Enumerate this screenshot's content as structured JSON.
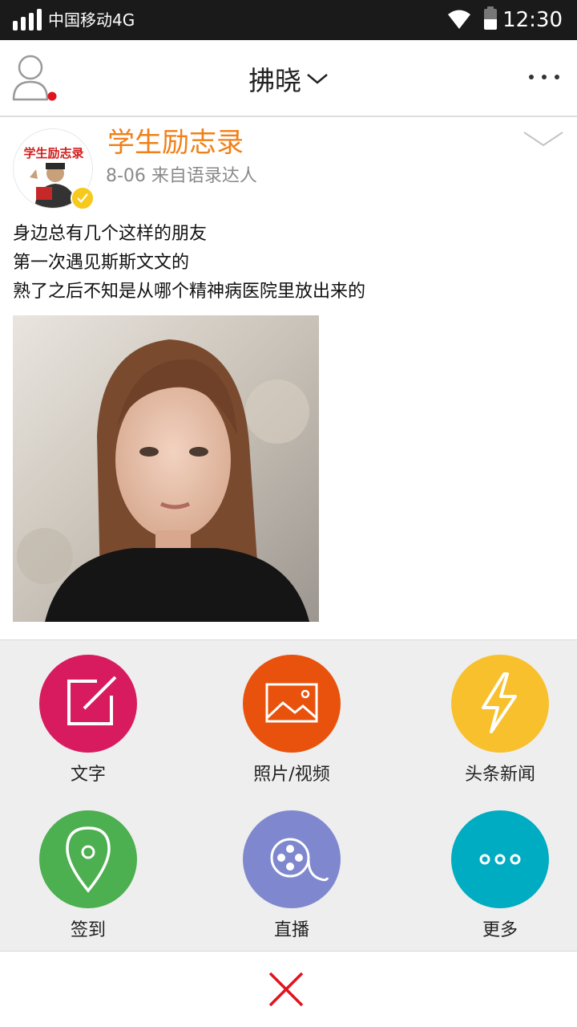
{
  "status_bar": {
    "carrier": "中国移动4G",
    "time": "12:30",
    "icons": [
      "signal-icon",
      "wifi-icon",
      "battery-icon"
    ]
  },
  "top_bar": {
    "title": "拂晓",
    "icons": [
      "user-avatar-icon",
      "chevron-down-icon",
      "more-icon"
    ],
    "notification_dot_color": "#e0141e"
  },
  "post": {
    "author": "学生励志录",
    "avatar_text": "学生励志录",
    "meta": "8-06 来自语录达人",
    "lines": [
      "身边总有几个这样的朋友",
      "第一次遇见斯斯文文的",
      "熟了之后不知是从哪个精神病医院里放出来的"
    ],
    "author_color": "#f08019"
  },
  "share_options": [
    {
      "label": "文字",
      "icon": "edit-icon",
      "color": "#d81b5f"
    },
    {
      "label": "照片/视频",
      "icon": "image-icon",
      "color": "#e8520c"
    },
    {
      "label": "头条新闻",
      "icon": "lightning-icon",
      "color": "#f8c02c"
    },
    {
      "label": "签到",
      "icon": "location-pin-icon",
      "color": "#4caf50"
    },
    {
      "label": "直播",
      "icon": "film-reel-icon",
      "color": "#7f88cf"
    },
    {
      "label": "更多",
      "icon": "more-icon",
      "color": "#00acc1"
    }
  ],
  "close_button": {
    "icon": "close-icon",
    "color": "#e0141e"
  }
}
